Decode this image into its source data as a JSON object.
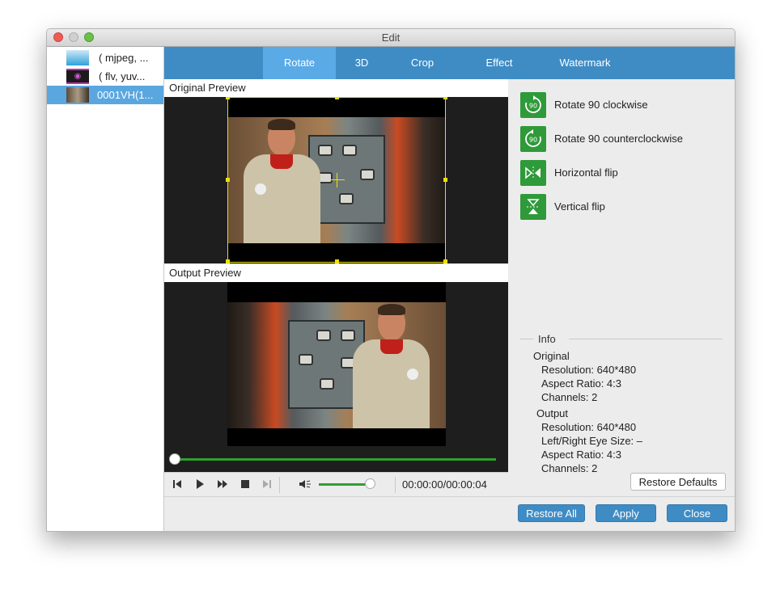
{
  "window": {
    "title": "Edit"
  },
  "files": [
    {
      "name": "( mjpeg, ...",
      "selected": false
    },
    {
      "name": "( flv, yuv...",
      "selected": false
    },
    {
      "name": "0001VH(1...",
      "selected": true
    }
  ],
  "tabs": [
    {
      "label": "Rotate",
      "active": true
    },
    {
      "label": "3D",
      "active": false
    },
    {
      "label": "Crop",
      "active": false
    },
    {
      "label": "Effect",
      "active": false
    },
    {
      "label": "Watermark",
      "active": false
    }
  ],
  "preview": {
    "original_label": "Original Preview",
    "output_label": "Output Preview",
    "seek_progress": 0.0,
    "volume": 0.9,
    "timecode": "00:00:00/00:00:04"
  },
  "actions": [
    {
      "label": "Rotate 90 clockwise",
      "icon": "rotate-clockwise-icon"
    },
    {
      "label": "Rotate 90 counterclockwise",
      "icon": "rotate-counterclockwise-icon"
    },
    {
      "label": "Horizontal flip",
      "icon": "horizontal-flip-icon"
    },
    {
      "label": "Vertical flip",
      "icon": "vertical-flip-icon"
    }
  ],
  "info": {
    "title": "Info",
    "original_heading": "Original",
    "original_resolution": "Resolution: 640*480",
    "original_aspect": "Aspect Ratio: 4:3",
    "original_channels": "Channels: 2",
    "output_heading": "Output",
    "output_resolution": "Resolution: 640*480",
    "output_eye_size": "Left/Right Eye Size: –",
    "output_aspect": "Aspect Ratio: 4:3",
    "output_channels": "Channels: 2"
  },
  "buttons": {
    "restore_defaults": "Restore Defaults",
    "restore_all": "Restore All",
    "apply": "Apply",
    "close": "Close"
  },
  "colors": {
    "accent": "#3f8cc5",
    "active_tab": "#5aaae6",
    "action_green": "#2f9a39",
    "selection": "#5aa7e0"
  }
}
